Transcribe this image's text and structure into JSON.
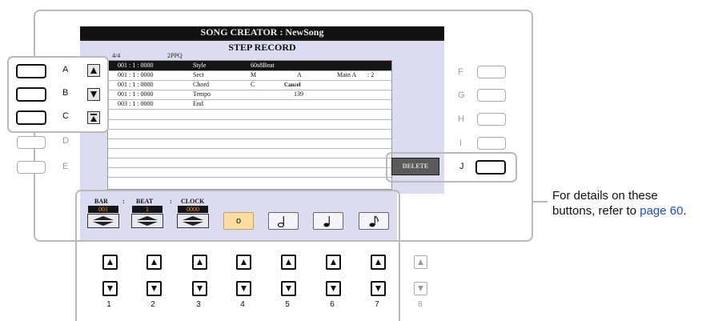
{
  "screen_title": "SONG CREATOR : NewSong",
  "page_heading": "STEP RECORD",
  "time_signature": "4/4",
  "resolution": "2PPQ",
  "events": [
    {
      "position": "001 : 1 : 0000",
      "type": "Style",
      "value1": "60s8Beat",
      "value2": "",
      "value3": "",
      "value4": ""
    },
    {
      "position": "001 : 1 : 0000",
      "type": "Sect",
      "value1": "M",
      "value2": "A",
      "value3": "Main A",
      "value4": ": 2"
    },
    {
      "position": "001 : 1 : 0000",
      "type": "Chord",
      "value1": "C",
      "value2": "Cancel",
      "value3": "",
      "value4": ""
    },
    {
      "position": "001 : 1 : 0000",
      "type": "Tempo",
      "value1": "",
      "value2": "139",
      "value3": "",
      "value4": ""
    },
    {
      "position": "003 : 1 : 0000",
      "type": "End",
      "value1": "",
      "value2": "",
      "value3": "",
      "value4": ""
    }
  ],
  "delete_label": "DELETE",
  "left_buttons": [
    "A",
    "B",
    "C",
    "D",
    "E"
  ],
  "right_buttons": [
    "F",
    "G",
    "H",
    "I",
    "J"
  ],
  "bar_label": "BAR",
  "beat_label": "BEAT",
  "clock_label": "CLOCK",
  "sep": ":",
  "bar_value": "001",
  "beat_value": "1",
  "clock_value": "0000",
  "note_buttons": [
    {
      "icon": "whole-note",
      "glyph": "𝅝",
      "selected": true
    },
    {
      "icon": "half-note",
      "glyph": "𝅗𝅥",
      "selected": false
    },
    {
      "icon": "quarter-note",
      "glyph": "♩",
      "selected": false
    },
    {
      "icon": "eighth-note",
      "glyph": "♪",
      "selected": false
    }
  ],
  "panel_numbers": [
    "1",
    "2",
    "3",
    "4",
    "5",
    "6",
    "7",
    "8"
  ],
  "note_text": "For details on these buttons, refer to",
  "note_link": "page 60",
  "note_end": ".",
  "colors": {
    "lcd_bg": "#dcdcf0",
    "value_orange": "#ff9a1e",
    "link_blue": "#1a4fd6",
    "frame_gray": "#b9b9b9"
  }
}
